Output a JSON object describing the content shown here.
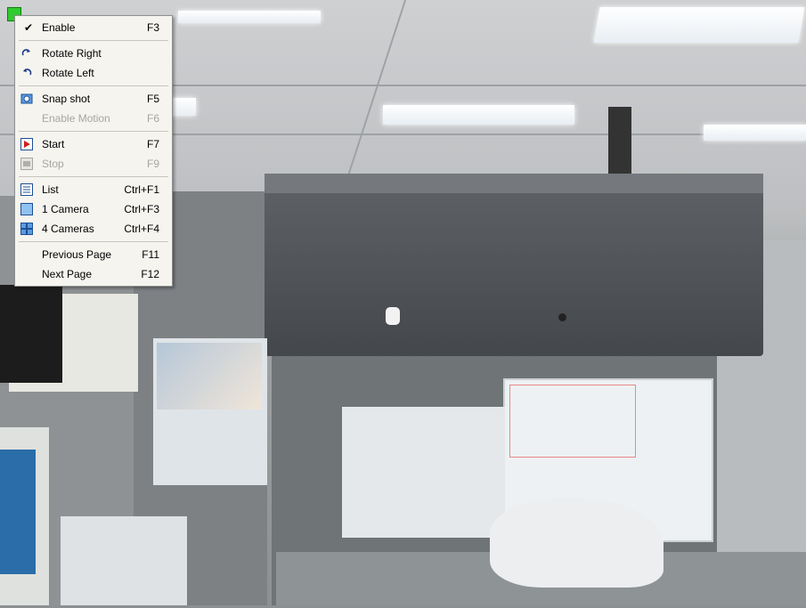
{
  "window": {
    "title": ""
  },
  "camera_view": {
    "description_icon": "camera-feed",
    "indicator_color": "#2fcb2f"
  },
  "context_menu": {
    "items": [
      {
        "label": "Enable",
        "shortcut": "F3",
        "checked": true,
        "disabled": false,
        "icon": "checkmark-icon"
      },
      {
        "label": "Rotate Right",
        "shortcut": "",
        "checked": false,
        "disabled": false,
        "icon": "rotate-right-icon"
      },
      {
        "label": "Rotate Left",
        "shortcut": "",
        "checked": false,
        "disabled": false,
        "icon": "rotate-left-icon"
      },
      {
        "label": "Snap shot",
        "shortcut": "F5",
        "checked": false,
        "disabled": false,
        "icon": "camera-icon"
      },
      {
        "label": "Enable Motion",
        "shortcut": "F6",
        "checked": false,
        "disabled": true,
        "icon": ""
      },
      {
        "label": "Start",
        "shortcut": "F7",
        "checked": false,
        "disabled": false,
        "icon": "play-icon"
      },
      {
        "label": "Stop",
        "shortcut": "F9",
        "checked": false,
        "disabled": true,
        "icon": "stop-icon"
      },
      {
        "label": "List",
        "shortcut": "Ctrl+F1",
        "checked": false,
        "disabled": false,
        "icon": "list-icon"
      },
      {
        "label": "1 Camera",
        "shortcut": "Ctrl+F3",
        "checked": false,
        "disabled": false,
        "icon": "single-view-icon"
      },
      {
        "label": "4 Cameras",
        "shortcut": "Ctrl+F4",
        "checked": false,
        "disabled": false,
        "icon": "quad-view-icon"
      },
      {
        "label": "Previous Page",
        "shortcut": "F11",
        "checked": false,
        "disabled": false,
        "icon": ""
      },
      {
        "label": "Next Page",
        "shortcut": "F12",
        "checked": false,
        "disabled": false,
        "icon": ""
      }
    ]
  },
  "colors": {
    "menu_bg": "#f5f4ee",
    "menu_border": "#8e8f8f",
    "disabled_text": "#a7a69f",
    "accent_blue": "#2f6fc4",
    "accent_red": "#d11f1f"
  }
}
